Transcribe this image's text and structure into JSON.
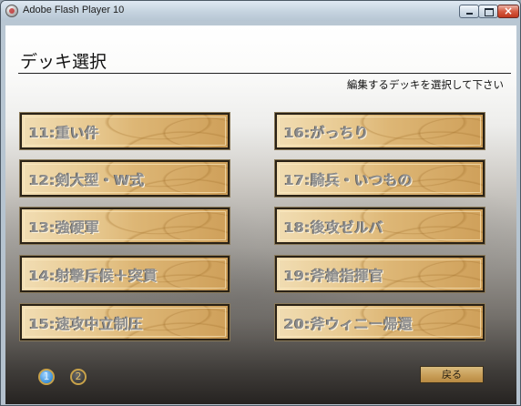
{
  "window": {
    "title": "Adobe Flash Player 10",
    "icon": "flash-player-icon"
  },
  "screen": {
    "heading": "デッキ選択",
    "instruction": "編集するデッキを選択して下さい"
  },
  "decks": [
    "11:重い件",
    "12:剣大型・W式",
    "13:強硬軍",
    "14:射撃斥候＋突貫",
    "15:速攻中立制圧",
    "16:がっちり",
    "17:騎兵・いつもの",
    "18:後攻ゼルバ",
    "19:斧槍指揮官",
    "20:斧ウィニー帰還"
  ],
  "pagination": {
    "pages": [
      "1",
      "2"
    ],
    "current": "1"
  },
  "back_label": "戻る",
  "colors": {
    "deck_button_fill": "#e3c182",
    "deck_label": "#8f8f8f",
    "page_active": "#3a8fd8",
    "page_ring": "#c8a24a"
  }
}
